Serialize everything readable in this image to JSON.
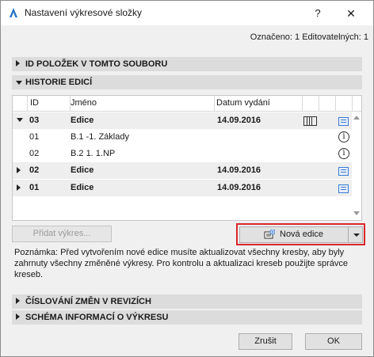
{
  "window": {
    "title": "Nastavení výkresové složky",
    "help": "?",
    "close": "✕"
  },
  "status": "Označeno: 1 Editovatelných: 1",
  "sections": {
    "id_items": "ID POLOŽEK V TOMTO SOUBORU",
    "history": "HISTORIE EDICÍ",
    "numbering": "ČÍSLOVÁNÍ ZMĚN V REVIZÍCH",
    "schema": "SCHÉMA INFORMACÍ O VÝKRESU"
  },
  "table": {
    "headers": {
      "id": "ID",
      "name": "Jméno",
      "date": "Datum vydání"
    },
    "rows": [
      {
        "id": "03",
        "name": "Edice",
        "date": "14.09.2016",
        "bold": true,
        "expanded": true
      },
      {
        "id": "01",
        "name": "B.1 -1. Základy",
        "date": "",
        "bold": false
      },
      {
        "id": "02",
        "name": "B.2 1. 1.NP",
        "date": "",
        "bold": false
      },
      {
        "id": "02",
        "name": "Edice",
        "date": "14.09.2016",
        "bold": true,
        "expanded": false
      },
      {
        "id": "01",
        "name": "Edice",
        "date": "14.09.2016",
        "bold": true,
        "expanded": false
      }
    ]
  },
  "buttons": {
    "add_drawing": "Přidat výkres...",
    "new_issue": "Nová edice",
    "cancel": "Zrušit",
    "ok": "OK"
  },
  "note": "Poznámka: Před vytvořením nové edice musíte aktualizovat všechny kresby, aby byly zahrnuty všechny změněné výkresy. Pro kontrolu a aktualizaci kreseb použijte správce kreseb.",
  "colors": {
    "highlight": "#d9262a",
    "accent": "#3a7bd5"
  }
}
